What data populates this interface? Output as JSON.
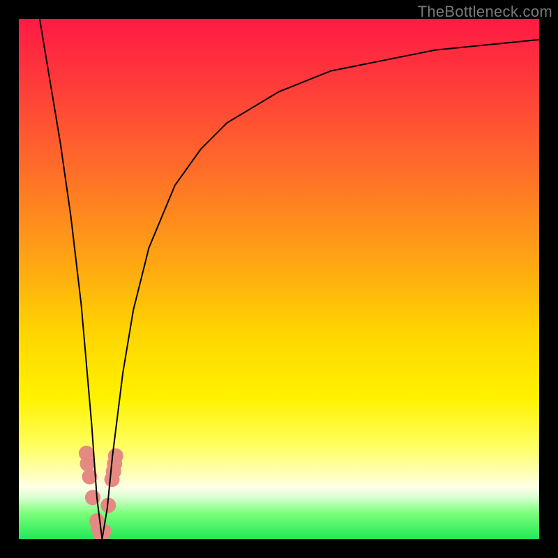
{
  "watermark": "TheBottleneck.com",
  "chart_data": {
    "type": "line",
    "title": "",
    "xlabel": "",
    "ylabel": "",
    "xlim": [
      0,
      100
    ],
    "ylim": [
      0,
      100
    ],
    "grid": false,
    "legend": false,
    "series": [
      {
        "name": "bottleneck-curve",
        "x": [
          4,
          6,
          8,
          10,
          12,
          14,
          15,
          16,
          17,
          18,
          20,
          22,
          25,
          30,
          35,
          40,
          50,
          60,
          70,
          80,
          90,
          100
        ],
        "values": [
          100,
          88,
          76,
          62,
          45,
          22,
          8,
          0,
          6,
          16,
          32,
          44,
          56,
          68,
          75,
          80,
          86,
          90,
          92,
          94,
          95,
          96
        ]
      }
    ],
    "markers": {
      "name": "highlight-region",
      "x": [
        13.0,
        13.2,
        13.6,
        14.2,
        15.0,
        15.3,
        15.8,
        16.3,
        17.2,
        17.9,
        18.2,
        18.4,
        18.6
      ],
      "values": [
        16.5,
        14.5,
        12.0,
        8.0,
        3.5,
        2.0,
        0.5,
        1.5,
        6.5,
        11.5,
        13.0,
        14.5,
        16.0
      ],
      "color": "#e58a82"
    },
    "background_gradient": {
      "top": "#ff1a44",
      "bottom": "#20e858"
    }
  }
}
